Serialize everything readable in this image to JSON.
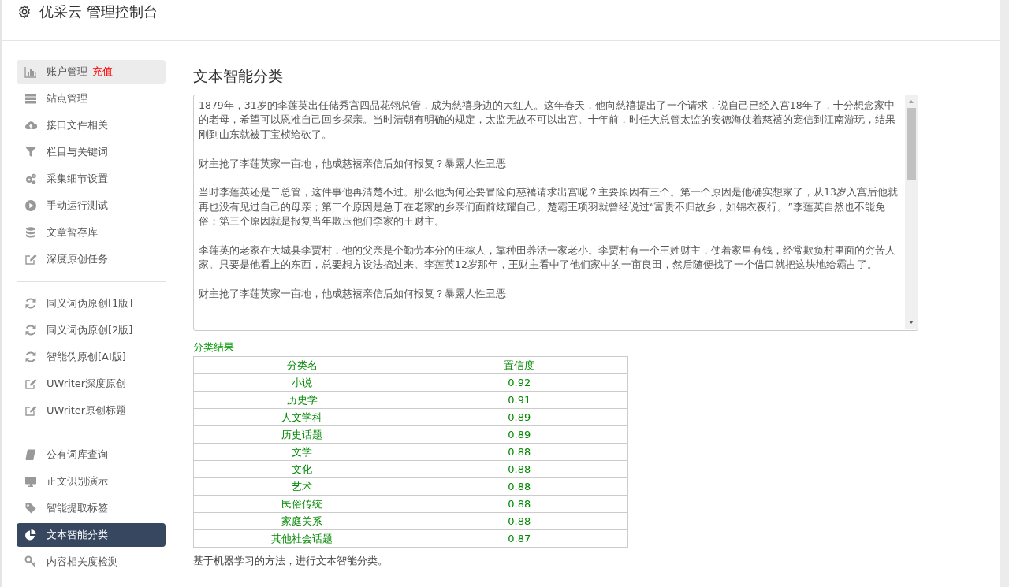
{
  "header": {
    "title": "优采云 管理控制台"
  },
  "sidebar": {
    "groups": [
      [
        {
          "label": "账户管理",
          "badge": "充值",
          "highlighted": true,
          "selected": false
        },
        {
          "label": "站点管理",
          "highlighted": false,
          "selected": false
        },
        {
          "label": "接口文件相关",
          "highlighted": false,
          "selected": false
        },
        {
          "label": "栏目与关键词",
          "highlighted": false,
          "selected": false
        },
        {
          "label": "采集细节设置",
          "highlighted": false,
          "selected": false
        },
        {
          "label": "手动运行测试",
          "highlighted": false,
          "selected": false
        },
        {
          "label": "文章暂存库",
          "highlighted": false,
          "selected": false
        },
        {
          "label": "深度原创任务",
          "highlighted": false,
          "selected": false
        }
      ],
      [
        {
          "label": "同义词伪原创[1版]",
          "highlighted": false,
          "selected": false
        },
        {
          "label": "同义词伪原创[2版]",
          "highlighted": false,
          "selected": false
        },
        {
          "label": "智能伪原创[AI版]",
          "highlighted": false,
          "selected": false
        },
        {
          "label": "UWriter深度原创",
          "highlighted": false,
          "selected": false
        },
        {
          "label": "UWriter原创标题",
          "highlighted": false,
          "selected": false
        }
      ],
      [
        {
          "label": "公有词库查询",
          "highlighted": false,
          "selected": false
        },
        {
          "label": "正文识别演示",
          "highlighted": false,
          "selected": false
        },
        {
          "label": "智能提取标签",
          "highlighted": false,
          "selected": false
        },
        {
          "label": "文本智能分类",
          "highlighted": false,
          "selected": true
        },
        {
          "label": "内容相关度检测",
          "highlighted": false,
          "selected": false
        }
      ]
    ]
  },
  "main": {
    "title": "文本智能分类",
    "text_area": {
      "paragraphs": [
        "1879年，31岁的李莲英出任储秀宫四品花翎总管，成为慈禧身边的大红人。这年春天，他向慈禧提出了一个请求，说自己已经入宫18年了，十分想念家中的老母，希望可以恩准自己回乡探亲。当时清朝有明确的规定，太监无故不可以出宫。十年前，时任大总管太监的安德海仗着慈禧的宠信到江南游玩，结果刚到山东就被丁宝桢给砍了。",
        "财主抢了李莲英家一亩地，他成慈禧亲信后如何报复？暴露人性丑恶",
        "当时李莲英还是二总管，这件事他再清楚不过。那么他为何还要冒险向慈禧请求出宫呢？主要原因有三个。第一个原因是他确实想家了，从13岁入宫后他就再也没有见过自己的母亲；第二个原因是急于在老家的乡亲们面前炫耀自己。楚霸王项羽就曾经说过“富贵不归故乡，如锦衣夜行。”李莲英自然也不能免俗；第三个原因就是报复当年欺压他们李家的王财主。",
        "李莲英的老家在大城县李贾村，他的父亲是个勤劳本分的庄稼人，靠种田养活一家老小。李贾村有一个王姓财主，仗着家里有钱，经常欺负村里面的穷苦人家。只要是他看上的东西，总要想方设法搞过来。李莲英12岁那年，王财主看中了他们家中的一亩良田，然后随便找了一个借口就把这块地给霸占了。",
        "财主抢了李莲英家一亩地，他成慈禧亲信后如何报复？暴露人性丑恶"
      ]
    },
    "result_label": "分类结果",
    "table": {
      "columns": [
        "分类名",
        "置信度"
      ],
      "rows": [
        [
          "小说",
          "0.92"
        ],
        [
          "历史学",
          "0.91"
        ],
        [
          "人文学科",
          "0.89"
        ],
        [
          "历史话题",
          "0.89"
        ],
        [
          "文学",
          "0.88"
        ],
        [
          "文化",
          "0.88"
        ],
        [
          "艺术",
          "0.88"
        ],
        [
          "民俗传统",
          "0.88"
        ],
        [
          "家庭关系",
          "0.88"
        ],
        [
          "其他社会话题",
          "0.87"
        ]
      ]
    },
    "note": "基于机器学习的方法，进行文本智能分类。"
  }
}
